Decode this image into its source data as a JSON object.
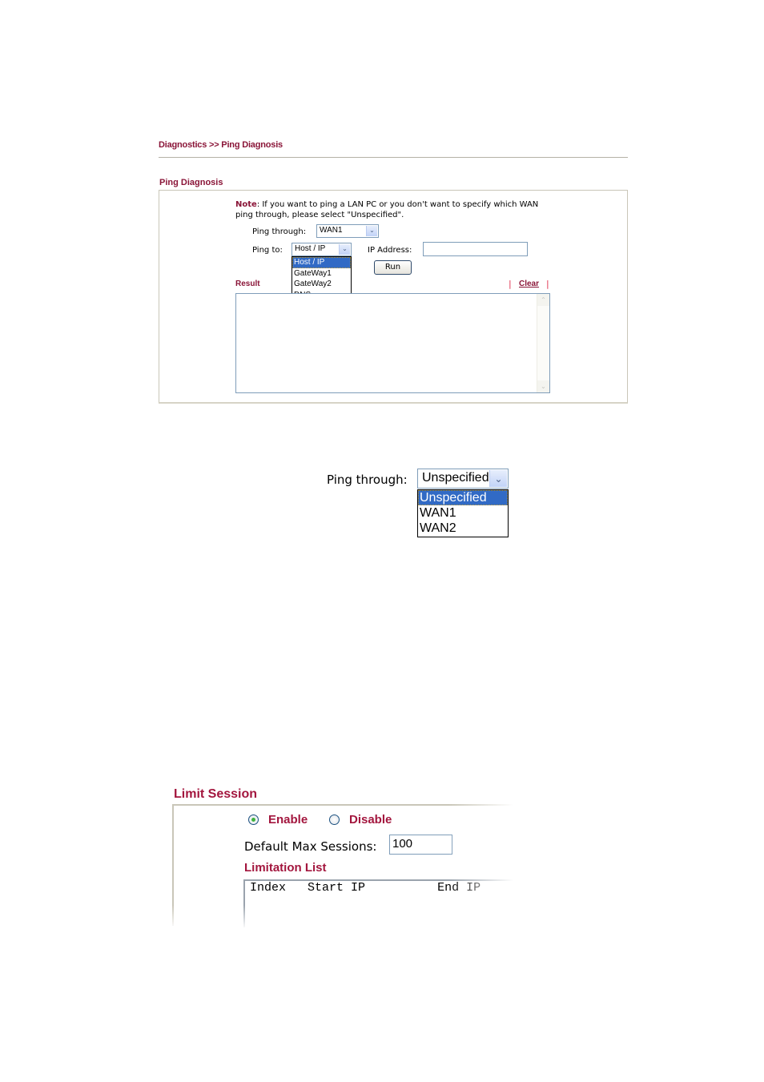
{
  "ping_diagnosis": {
    "breadcrumb": "Diagnostics >> Ping Diagnosis",
    "section_title": "Ping Diagnosis",
    "note_label": "Note",
    "note_text": ": If you want to ping a LAN PC or you don't want to specify which WAN ping through, please select \"Unspecified\".",
    "ping_through_label": "Ping through:",
    "ping_through_value": "WAN1",
    "ping_to_label": "Ping to:",
    "ping_to_value": "Host / IP",
    "ping_to_options": [
      "Host / IP",
      "GateWay1",
      "GateWay2",
      "DNS"
    ],
    "ping_to_selected_index": 0,
    "ip_address_label": "IP Address:",
    "ip_address_value": "",
    "run_button": "Run",
    "result_label": "Result",
    "clear_link": "Clear",
    "pipe": "|",
    "result_text": ""
  },
  "ping_through_dropdown": {
    "label": "Ping through:",
    "value": "Unspecified",
    "options": [
      "Unspecified",
      "WAN1",
      "WAN2"
    ],
    "selected_index": 0
  },
  "limit_session": {
    "title": "Limit Session",
    "enable_label": "Enable",
    "disable_label": "Disable",
    "selected": "Enable",
    "default_max_label": "Default Max Sessions:",
    "default_max_value": "100",
    "limitation_list_title": "Limitation List",
    "list_columns": [
      "Index",
      "Start IP",
      "End IP"
    ]
  }
}
